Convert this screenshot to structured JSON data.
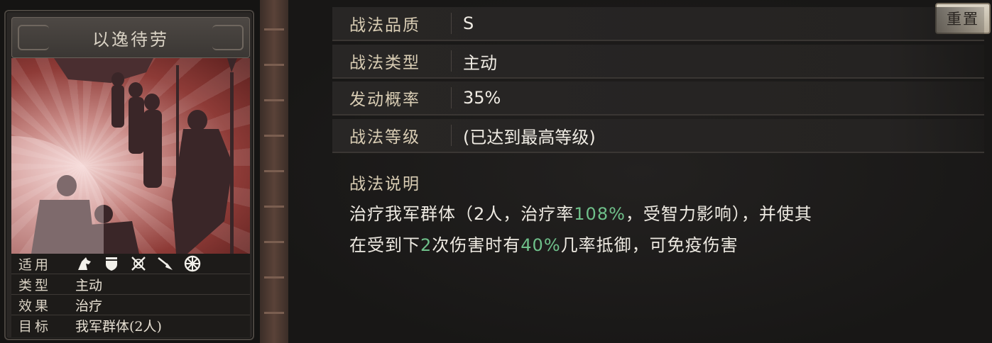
{
  "card": {
    "title": "以逸待劳",
    "attributes": [
      {
        "key": "适用",
        "type": "icons"
      },
      {
        "key": "类型",
        "value": "主动"
      },
      {
        "key": "效果",
        "value": "治疗"
      },
      {
        "key": "目标",
        "value": "我军群体(2人)"
      }
    ],
    "applicable_icons": [
      "cavalry-icon",
      "shield-icon",
      "crossed-weapons-icon",
      "spear-icon",
      "wheel-icon"
    ]
  },
  "panel": {
    "reset_label": "重置",
    "rows": [
      {
        "label": "战法品质",
        "value": "S"
      },
      {
        "label": "战法类型",
        "value": "主动"
      },
      {
        "label": "发动概率",
        "value": "35%"
      },
      {
        "label": "战法等级",
        "value": "(已达到最高等级)"
      }
    ],
    "description_title": "战法说明",
    "description": {
      "line1_a": "治疗我军群体（2人，治疗率",
      "line1_hl": "108%",
      "line1_b": "，受智力影响），并使其",
      "line2_a": "在受到下",
      "line2_hl1": "2",
      "line2_b": "次伤害时有",
      "line2_hl2": "40%",
      "line2_c": "几率抵御，可免疫伤害"
    }
  },
  "colors": {
    "highlight": "#6fc08a",
    "label": "#d9cdb4",
    "art_red": "#8e3b37"
  }
}
